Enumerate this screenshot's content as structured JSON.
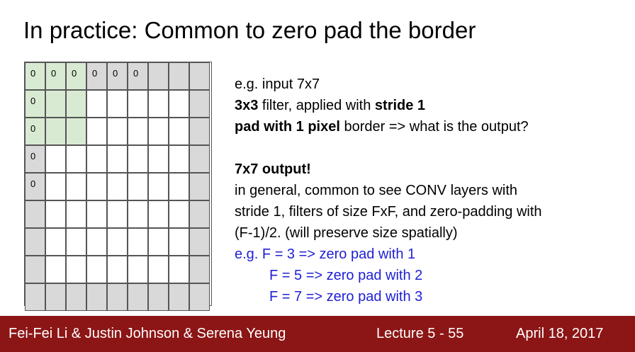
{
  "title": "In practice: Common to zero pad the border",
  "grid": {
    "top_row_labels": [
      "0",
      "0",
      "0",
      "0",
      "0",
      "0"
    ],
    "left_col_labels": [
      "0",
      "0",
      "0",
      "0"
    ]
  },
  "text": {
    "line1": "e.g. input 7x7",
    "line2_bold": "3x3",
    "line2_rest": " filter, applied with ",
    "line2_bold2": "stride 1",
    "line3_bold": "pad with 1 pixel",
    "line3_rest": " border => what is the output?",
    "line4_bold": "7x7 output!",
    "line5": "in general, common to see CONV layers with",
    "line6": "stride 1, filters of size FxF, and zero-padding with",
    "line7": "(F-1)/2. (will preserve size spatially)",
    "line8": "e.g. F = 3 => zero pad with 1",
    "line9": "F = 5 => zero pad with 2",
    "line10": "F = 7 => zero pad with 3"
  },
  "footer": {
    "authors": "Fei-Fei Li & Justin Johnson & Serena Yeung",
    "lecture": "Lecture 5 - 55",
    "date": "April 18, 2017"
  },
  "colors": {
    "footer_bg": "#8c1515",
    "blue_text": "#1f1fd6",
    "pad_cell": "#d9d9d9",
    "filter_highlight": "#d9ead3"
  }
}
